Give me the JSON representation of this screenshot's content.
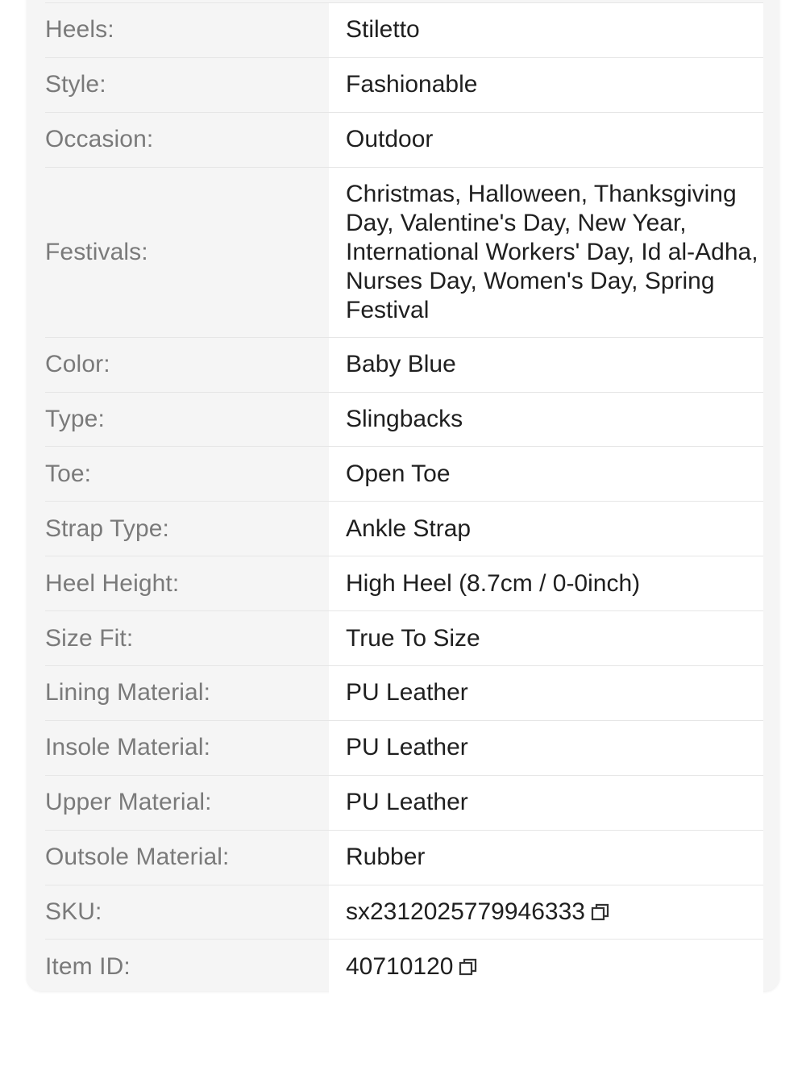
{
  "specs": [
    {
      "label": "Heels:",
      "value": "Stiletto"
    },
    {
      "label": "Style:",
      "value": "Fashionable"
    },
    {
      "label": "Occasion:",
      "value": "Outdoor"
    },
    {
      "label": "Festivals:",
      "value": "Christmas, Halloween, Thanksgiving Day, Valentine's Day, New Year, International Workers' Day, Id al-Adha, Nurses Day, Women's Day, Spring Festival"
    },
    {
      "label": "Color:",
      "value": "Baby Blue"
    },
    {
      "label": "Type:",
      "value": "Slingbacks"
    },
    {
      "label": "Toe:",
      "value": "Open Toe"
    },
    {
      "label": "Strap Type:",
      "value": "Ankle Strap"
    },
    {
      "label": "Heel Height:",
      "value": "High Heel (8.7cm / 0-0inch)"
    },
    {
      "label": "Size Fit:",
      "value": "True To Size"
    },
    {
      "label": "Lining Material:",
      "value": "PU Leather"
    },
    {
      "label": "Insole Material:",
      "value": "PU Leather"
    },
    {
      "label": "Upper Material:",
      "value": "PU Leather"
    },
    {
      "label": "Outsole Material:",
      "value": "Rubber"
    },
    {
      "label": "SKU:",
      "value": "sx2312025779946333",
      "copy_icon": "copy-icon"
    },
    {
      "label": "Item ID:",
      "value": "40710120",
      "copy_icon": "copy-icon"
    }
  ]
}
